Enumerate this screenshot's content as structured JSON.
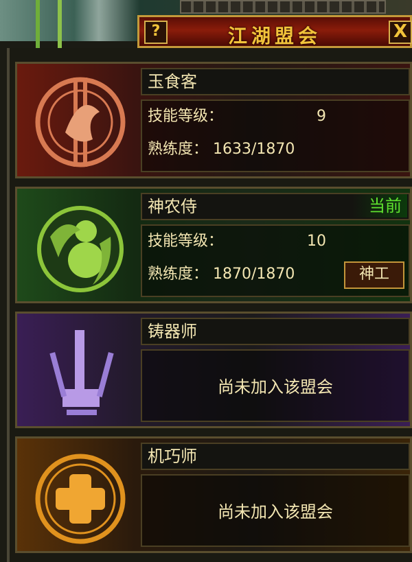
{
  "window": {
    "title": "江湖盟会",
    "help_label": "?",
    "close_label": "X"
  },
  "guilds": [
    {
      "name": "玉食客",
      "skill_label": "技能等级：",
      "skill_value": "9",
      "prof_label": "熟练度：",
      "prof_value": "1633/1870",
      "color": "#b8361e"
    },
    {
      "name": "神农侍",
      "skill_label": "技能等级：",
      "skill_value": "10",
      "prof_label": "熟练度：",
      "prof_value": "1870/1870",
      "status": "当前",
      "action_label": "神工",
      "color": "#5aa42a"
    },
    {
      "name": "铸器师",
      "not_joined": "尚未加入该盟会",
      "color": "#8a56c8"
    },
    {
      "name": "机巧师",
      "not_joined": "尚未加入该盟会",
      "color": "#e08a18"
    }
  ]
}
